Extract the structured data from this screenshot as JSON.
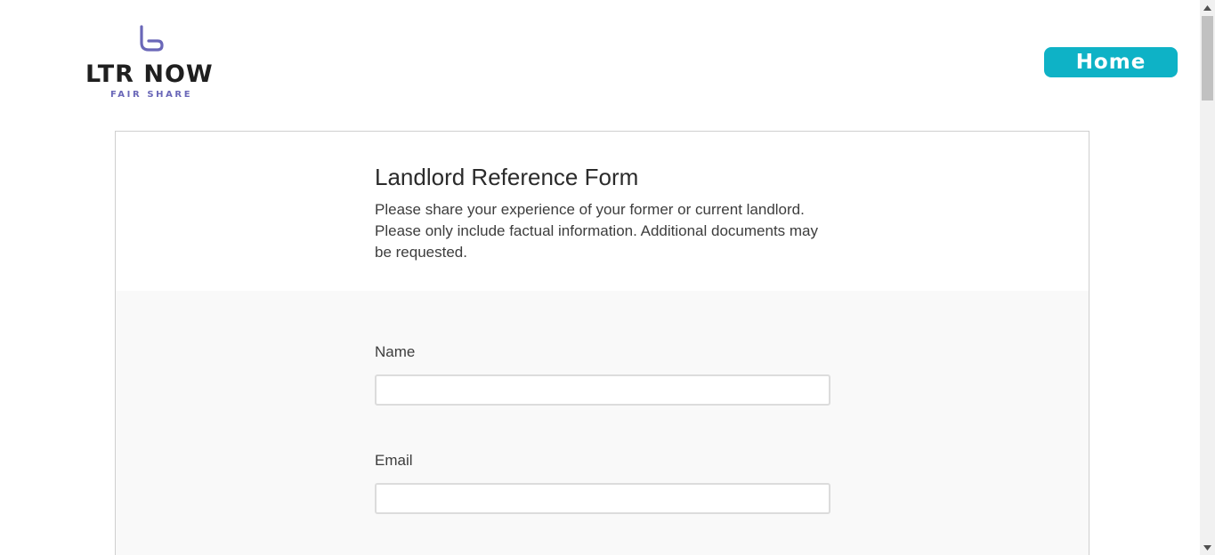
{
  "logo": {
    "title": "LTR NOW",
    "subtitle": "FAIR SHARE"
  },
  "header": {
    "home_label": "Home"
  },
  "form": {
    "title": "Landlord Reference Form",
    "description": "Please share your experience of your former or current landlord. Please only include factual information. Additional documents may be requested.",
    "fields": [
      {
        "label": "Name",
        "value": "",
        "placeholder": ""
      },
      {
        "label": "Email",
        "value": "",
        "placeholder": ""
      }
    ]
  },
  "colors": {
    "accent": "#0eb2c6",
    "logo_purple": "#6a67b8"
  }
}
